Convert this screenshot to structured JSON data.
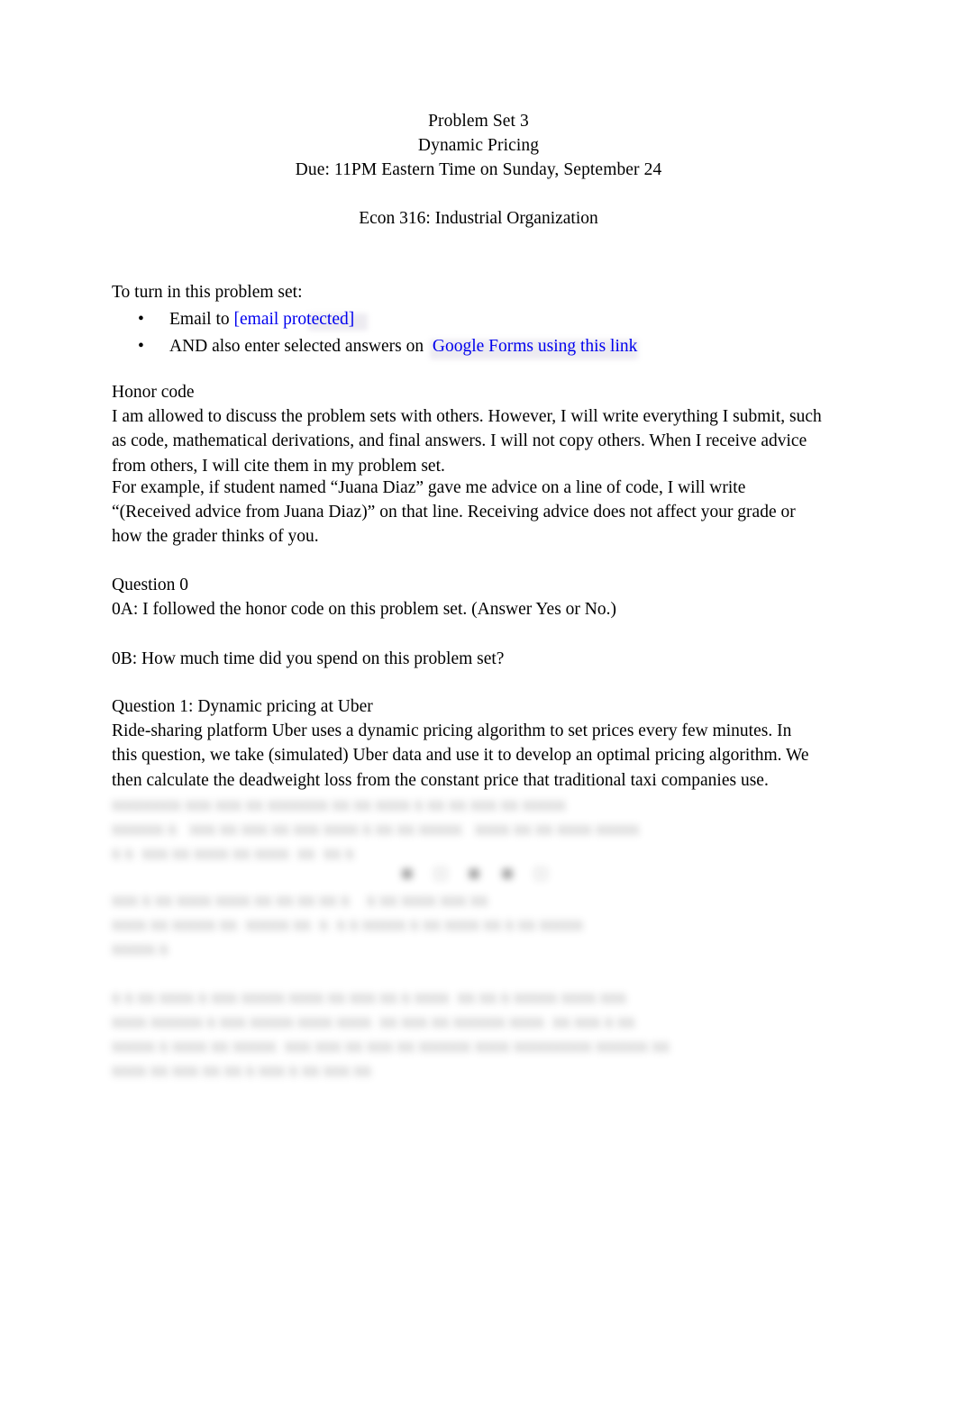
{
  "document": {
    "header": {
      "title_lines": [
        "Problem Set 3",
        "Dynamic Pricing",
        "Due: 11PM Eastern Time on Sunday, September 24"
      ],
      "course": "Econ 316: Industrial Organization"
    },
    "turn_in": {
      "intro": "To turn in this problem set:",
      "bullet_marker": "•",
      "items": [
        {
          "prefix": "Email to",
          "link_text": "[email protected]",
          "suffix": ""
        },
        {
          "prefix": "AND also enter selected answers on",
          "link_text": "Google Forms using this link",
          "suffix": ""
        }
      ]
    },
    "honor_code": {
      "heading": "Honor code",
      "paragraph_1": "I am allowed to discuss the problem sets with others. However, I will write everything I submit, such as code, mathematical derivations, and final answers. I will not copy others. When I receive advice from others, I will cite them in my problem set.",
      "paragraph_2": "For example, if student named “Juana Diaz” gave me advice on a line of code, I will write “(Received advice from Juana Diaz)” on that line. Receiving advice does not affect your grade or how the grader thinks of you."
    },
    "question_0": {
      "heading": "Question 0",
      "part_a": "0A: I followed the honor code on this problem set. (Answer Yes or No.)",
      "part_b": "0B: How much time did you spend on this problem set?"
    },
    "question_1": {
      "heading": "Question 1: Dynamic pricing at Uber",
      "intro": "Ride-sharing platform Uber uses a dynamic pricing algorithm to set prices every few minutes. In this question, we take (simulated) Uber data and use it to develop an optimal pricing algorithm. We then calculate the deadweight loss from the constant price that traditional taxi companies use."
    },
    "redacted": {
      "note": "illegible blurred text",
      "block_1": "xxxxxxxx xxx xxx xx xxxxxxx xx xx xxxx x xx xx xxx xx xxxxx\nxxxxxx x   xxx xx xxx xx xxx xxxx x xx xx xxxxx   xxxx xx xx xxxx xxxxx\nx x  xxx xx xxxx xx xxxx  xx  xx x",
      "equation": "■  □  ■  ■  □",
      "block_2": "xxx x xx xxxx xxxx xx xx xx xx x    x xx xxxx xxx xx\nxxxx xx xxxxx xx  xxxxx xx  x  x x xxxxx x xx xxxx xx x xx xxxxx\nxxxxx x",
      "block_3": "x x xx xxxx x xxx xxxxx xxxx xx xxx xx x xxxx  xx xx x xxxxx xxxx xxx\nxxxx xxxxxx x xxx xxxxx xxxx xxxx  xx xxx xx xxxxxx xxxx  xx xxx x xx\nxxxxx x xxxx xx xxxxx  xxx xxx xx xxx xx xxxxxx xxxx xxxxxxxxx xxxxxx xx\nxxxx xx xxx xx xx x xxx x xx xxx xx"
    }
  }
}
